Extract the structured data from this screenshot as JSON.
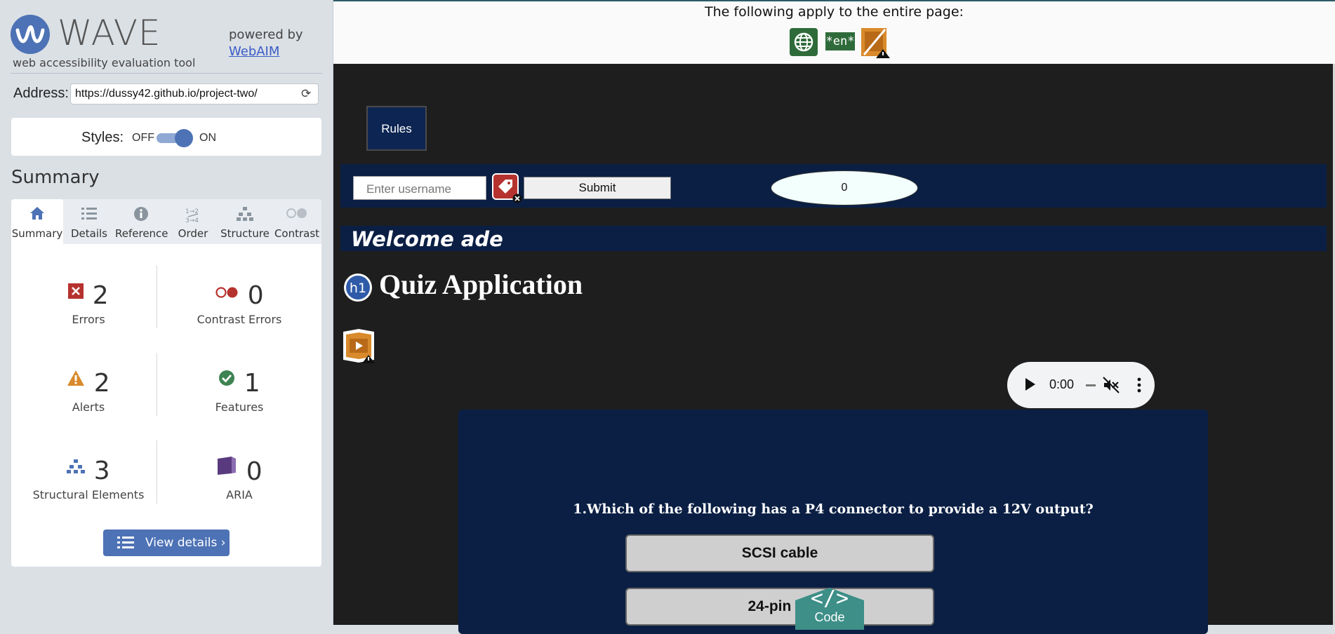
{
  "wave": {
    "logo_word": "WAVE",
    "tagline": "web accessibility evaluation tool",
    "powered_by": "powered by",
    "webaim_link": "WebAIM",
    "address_label": "Address:",
    "address_value": "https://dussy42.github.io/project-two/",
    "styles_label": "Styles:",
    "styles_off": "OFF",
    "styles_on": "ON",
    "styles_state": "on",
    "summary_title": "Summary",
    "tabs": [
      {
        "label": "Summary",
        "icon": "home-icon",
        "active": true
      },
      {
        "label": "Details",
        "icon": "list-icon"
      },
      {
        "label": "Reference",
        "icon": "info-icon"
      },
      {
        "label": "Order",
        "icon": "order-icon"
      },
      {
        "label": "Structure",
        "icon": "structure-icon"
      },
      {
        "label": "Contrast",
        "icon": "contrast-icon"
      }
    ],
    "stats": {
      "errors": {
        "value": "2",
        "label": "Errors"
      },
      "contrast_errors": {
        "value": "0",
        "label": "Contrast Errors"
      },
      "alerts": {
        "value": "2",
        "label": "Alerts"
      },
      "features": {
        "value": "1",
        "label": "Features"
      },
      "structural": {
        "value": "3",
        "label": "Structural Elements"
      },
      "aria": {
        "value": "0",
        "label": "ARIA"
      }
    },
    "view_details": "View details ›"
  },
  "site": {
    "page_notice": "The following apply to the entire page:",
    "lang_badge": "*en*",
    "rules_button": "Rules",
    "username_placeholder": "Enter username",
    "submit_button": "Submit",
    "score": "0",
    "welcome": "Welcome ade",
    "h1_badge": "h1",
    "title": "Quiz Application",
    "audio_time": "0:00",
    "question": "1.Which of the following has a P4 connector to provide a 12V output?",
    "answers": [
      "SCSI cable",
      "24-pin ac"
    ],
    "code_glyph": "</>",
    "code_label": "Code"
  },
  "colors": {
    "wave_blue": "#4d72b5",
    "site_bg": "#1e1e1f",
    "navy": "#0b1f44",
    "error_red": "#b5322e",
    "feature_green": "#3e8352",
    "alert_orange": "#d98a2c",
    "aria_purple": "#5a3a7e",
    "code_teal": "#3d8f88"
  }
}
